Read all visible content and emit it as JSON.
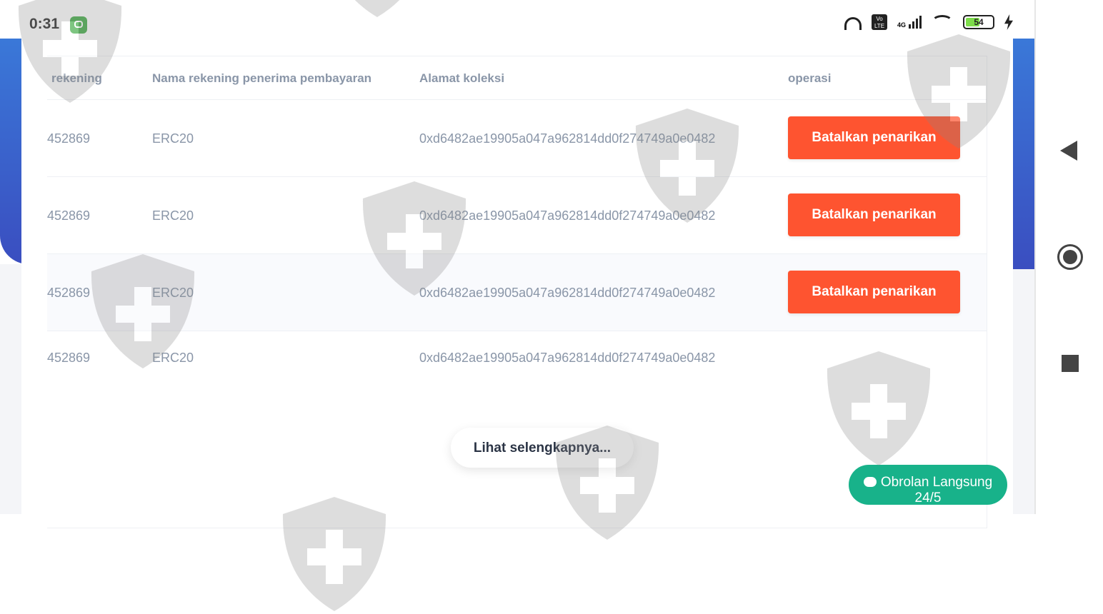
{
  "status_bar": {
    "time": "0:31",
    "network": "4G",
    "volte": "Vo LTE",
    "battery_level": "54",
    "battery_fraction": 0.54,
    "icons": [
      "app-notification-icon",
      "headphones-icon",
      "volte-icon",
      "signal-icon",
      "wifi-icon",
      "battery-icon",
      "charging-icon"
    ]
  },
  "table": {
    "headers": [
      "rekening",
      "Nama rekening penerima pembayaran",
      "Alamat koleksi",
      "operasi"
    ],
    "rows": [
      {
        "account": "452869",
        "name": "ERC20",
        "address": "0xd6482ae19905a047a962814dd0f274749a0e0482",
        "action": "Batalkan penarikan"
      },
      {
        "account": "452869",
        "name": "ERC20",
        "address": "0xd6482ae19905a047a962814dd0f274749a0e0482",
        "action": "Batalkan penarikan"
      },
      {
        "account": "452869",
        "name": "ERC20",
        "address": "0xd6482ae19905a047a962814dd0f274749a0e0482",
        "action": "Batalkan penarikan"
      },
      {
        "account": "452869",
        "name": "ERC20",
        "address": "0xd6482ae19905a047a962814dd0f274749a0e0482",
        "action": ""
      }
    ]
  },
  "more_button": "Lihat selengkapnya...",
  "chat_button": {
    "label": "Obrolan Langsung",
    "hours": "24/5"
  },
  "nav_bar": {
    "icons": [
      "back-icon",
      "home-icon",
      "recents-icon"
    ]
  },
  "colors": {
    "accent": "#fe5430",
    "chat": "#18b28a",
    "header_blue": "#3a78d8",
    "text_muted": "#8a96a8"
  }
}
